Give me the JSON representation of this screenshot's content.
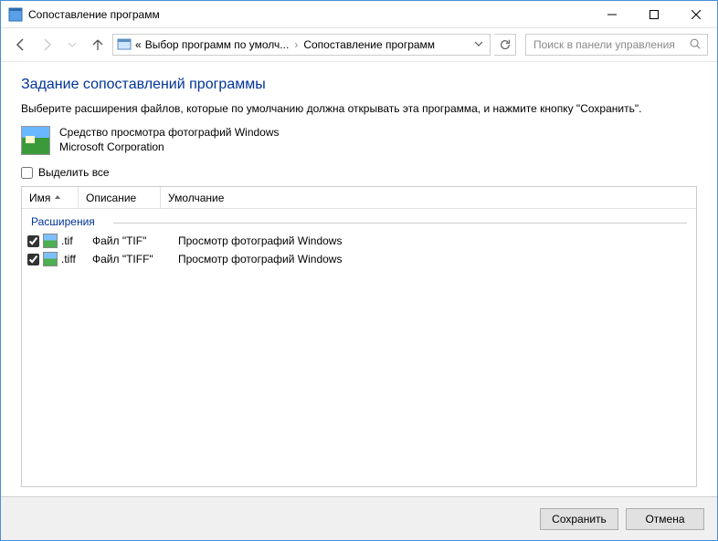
{
  "window": {
    "title": "Сопоставление программ"
  },
  "breadcrumb": {
    "prefix": "«",
    "part1": "Выбор программ по умолч...",
    "part2": "Сопоставление программ"
  },
  "search": {
    "placeholder": "Поиск в панели управления"
  },
  "page": {
    "title": "Задание сопоставлений программы",
    "instruction": "Выберите расширения файлов, которые по умолчанию должна открывать эта программа, и нажмите кнопку \"Сохранить\"."
  },
  "program": {
    "name": "Средство просмотра фотографий Windows",
    "publisher": "Microsoft Corporation"
  },
  "select_all": {
    "label": "Выделить все",
    "checked": false
  },
  "columns": {
    "name": "Имя",
    "description": "Описание",
    "default": "Умолчание"
  },
  "group": {
    "label": "Расширения"
  },
  "rows": [
    {
      "checked": true,
      "ext": ".tif",
      "desc": "Файл \"TIF\"",
      "def": "Просмотр фотографий Windows"
    },
    {
      "checked": true,
      "ext": ".tiff",
      "desc": "Файл \"TIFF\"",
      "def": "Просмотр фотографий Windows"
    }
  ],
  "buttons": {
    "save": "Сохранить",
    "cancel": "Отмена"
  }
}
